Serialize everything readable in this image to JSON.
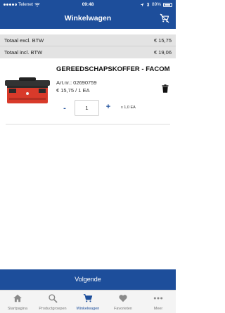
{
  "status": {
    "carrier": "Telenet",
    "time": "09:48",
    "battery": "89%",
    "battery_level": 0.89
  },
  "header": {
    "title": "Winkelwagen"
  },
  "totals": {
    "excl_label": "Totaal excl. BTW",
    "excl_value": "€ 15,75",
    "incl_label": "Totaal incl. BTW",
    "incl_value": "€ 19,06"
  },
  "item": {
    "name": "GEREEDSCHAPSKOFFER - FACOM",
    "artnr": "Art.nr.: 02690759",
    "price": "€ 15,75 / 1 EA",
    "quantity": "1",
    "minus": "-",
    "plus": "+",
    "multiplier": "x 1,0 EA"
  },
  "next_button": "Volgende",
  "tabs": [
    {
      "label": "Startpagina",
      "icon": "home-icon"
    },
    {
      "label": "Productgroepen",
      "icon": "search-icon"
    },
    {
      "label": "Winkelwagen",
      "icon": "cart-icon",
      "active": true
    },
    {
      "label": "Favorieten",
      "icon": "heart-icon"
    },
    {
      "label": "Meer",
      "icon": "more-icon"
    }
  ],
  "colors": {
    "primary": "#1d4e9b",
    "totals_bg": "#e3e3e3",
    "tab_inactive": "#7a7a7a"
  }
}
